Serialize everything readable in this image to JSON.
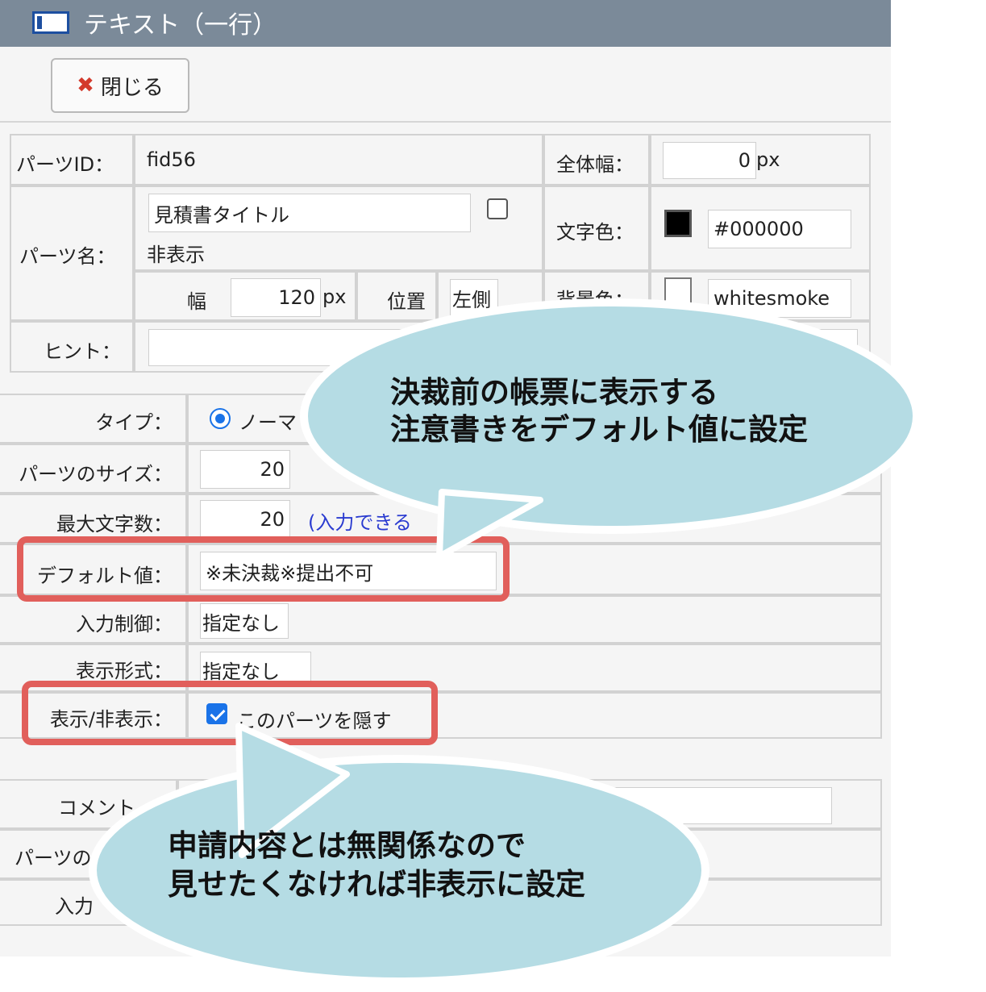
{
  "window": {
    "title": "テキスト（一行）"
  },
  "toolbar": {
    "close_label": "閉じる"
  },
  "top_table": {
    "parts_id_label": "パーツID：",
    "parts_id_value": "fid56",
    "total_width_label": "全体幅：",
    "total_width_value": "0",
    "px_unit": "px",
    "parts_name_label": "パーツ名：",
    "parts_name_value": "見積書タイトル",
    "hide_label": "非表示",
    "text_color_label": "文字色：",
    "text_color_value": "#000000",
    "width_label": "幅",
    "width_value": "120",
    "position_label": "位置",
    "position_value": "左側",
    "bg_color_label": "背景色：",
    "bg_color_value": "whitesmoke",
    "hint_label": "ヒント："
  },
  "bottom_table": {
    "type_label": "タイプ：",
    "type_value": "ノーマ",
    "size_label": "パーツのサイズ：",
    "size_value": "20",
    "maxchars_label": "最大文字数：",
    "maxchars_value": "20",
    "maxchars_note": "(入力できる",
    "default_label": "デフォルト値：",
    "default_value": "※未決裁※提出不可",
    "input_control_label": "入力制御：",
    "input_control_value": "指定なし",
    "display_format_label": "表示形式：",
    "display_format_value": "指定なし",
    "visibility_label": "表示/非表示：",
    "hide_part_label": "このパーツを隠す",
    "hide_part_checked": true,
    "comment_label": "コメント",
    "parts_label_partial": "パーツの",
    "input_label_partial": "入力"
  },
  "callouts": {
    "top": [
      "決裁前の帳票に表示する",
      "注意書きをデフォルト値に設定"
    ],
    "bottom": [
      "申請内容とは無関係なので",
      "見せたくなければ非表示に設定"
    ]
  },
  "colors": {
    "titlebar": "#7b8a99",
    "highlight": "#e15f5b",
    "bubble": "#b5dce4",
    "accent": "#1a73e8"
  }
}
